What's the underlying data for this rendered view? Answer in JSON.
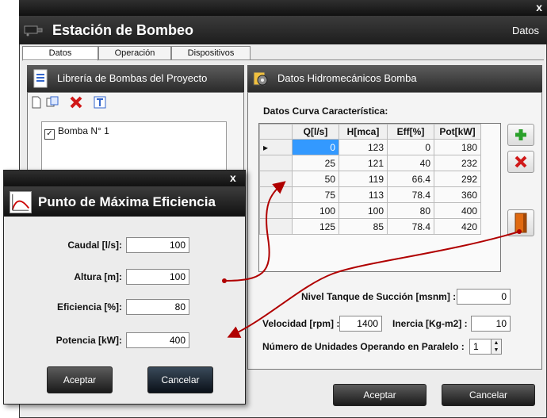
{
  "app": {
    "title": "Estación de Bombeo",
    "top_right": "Datos",
    "close": "x"
  },
  "tabs": [
    {
      "label": "Datos"
    },
    {
      "label": "Operación"
    },
    {
      "label": "Dispositivos"
    }
  ],
  "left_panel": {
    "title": "Librería de Bombas del Proyecto",
    "items": [
      {
        "label": "Bomba N° 1",
        "checked": true
      }
    ]
  },
  "right_panel": {
    "title": "Datos Hidromecánicos Bomba",
    "curve_label": "Datos Curva Característica:",
    "columns": [
      "Q[l/s]",
      "H[mca]",
      "Eff[%]",
      "Pot[kW]"
    ],
    "rows": [
      [
        "0",
        "123",
        "0",
        "180"
      ],
      [
        "25",
        "121",
        "40",
        "232"
      ],
      [
        "50",
        "119",
        "66.4",
        "292"
      ],
      [
        "75",
        "113",
        "78.4",
        "360"
      ],
      [
        "100",
        "100",
        "80",
        "400"
      ],
      [
        "125",
        "85",
        "78.4",
        "420"
      ]
    ],
    "nivel_label": "Nivel Tanque de Succión [msnm] :",
    "nivel_value": "0",
    "velocidad_label": "Velocidad [rpm] :",
    "velocidad_value": "1400",
    "inercia_label": "Inercia [Kg-m2] :",
    "inercia_value": "10",
    "unidades_label": "Número de Unidades Operando en Paralelo :",
    "unidades_value": "1",
    "row_pointer": "▸"
  },
  "footer": {
    "accept": "Aceptar",
    "cancel": "Cancelar"
  },
  "dialog": {
    "close": "x",
    "title": "Punto de Máxima Eficiencia",
    "caudal_label": "Caudal [l/s]:",
    "caudal_value": "100",
    "altura_label": "Altura [m]:",
    "altura_value": "100",
    "eficiencia_label": "Eficiencia [%]:",
    "eficiencia_value": "80",
    "potencia_label": "Potencia [kW]:",
    "potencia_value": "400",
    "accept": "Aceptar",
    "cancel": "Cancelar"
  },
  "colors": {
    "accent_arrow": "#b00000",
    "selected_cell": "#3399ff",
    "dark_header": "#1d1d1d"
  }
}
